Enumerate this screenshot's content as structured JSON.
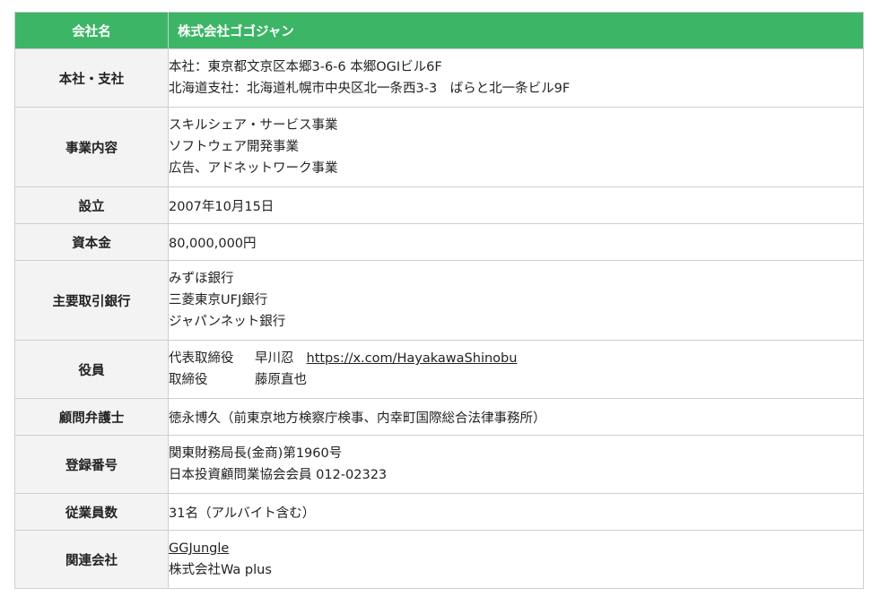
{
  "header": {
    "label": "会社名",
    "value": "株式会社ゴゴジャン"
  },
  "rows": {
    "hq": {
      "label": "本社・支社",
      "lines": [
        "本社：東京都文京区本郷3-6-6 本郷OGIビル6F",
        "北海道支社：北海道札幌市中央区北一条西3-3　ばらと北一条ビル9F"
      ]
    },
    "business": {
      "label": "事業内容",
      "lines": [
        "スキルシェア・サービス事業",
        "ソフトウェア開発事業",
        "広告、アドネットワーク事業"
      ]
    },
    "founded": {
      "label": "設立",
      "value": "2007年10月15日"
    },
    "capital": {
      "label": "資本金",
      "value": "80,000,000円"
    },
    "banks": {
      "label": "主要取引銀行",
      "lines": [
        "みずほ銀行",
        "三菱東京UFJ銀行",
        "ジャパンネット銀行"
      ]
    },
    "officers": {
      "label": "役員",
      "items": [
        {
          "role": "代表取締役",
          "name": "早川忍",
          "link": "https://x.com/HayakawaShinobu"
        },
        {
          "role": "取締役",
          "name": "藤原直也",
          "link": ""
        }
      ]
    },
    "lawyer": {
      "label": "顧問弁護士",
      "value": "徳永博久（前東京地方検察庁検事、内幸町国際総合法律事務所）"
    },
    "registration": {
      "label": "登録番号",
      "lines": [
        "関東財務局長(金商)第1960号",
        "日本投資顧問業協会会員 012-02323"
      ]
    },
    "employees": {
      "label": "従業員数",
      "value": "31名（アルバイト含む）"
    },
    "affiliates": {
      "label": "関連会社",
      "link": "GGJungle",
      "text": "株式会社Wa plus"
    }
  }
}
